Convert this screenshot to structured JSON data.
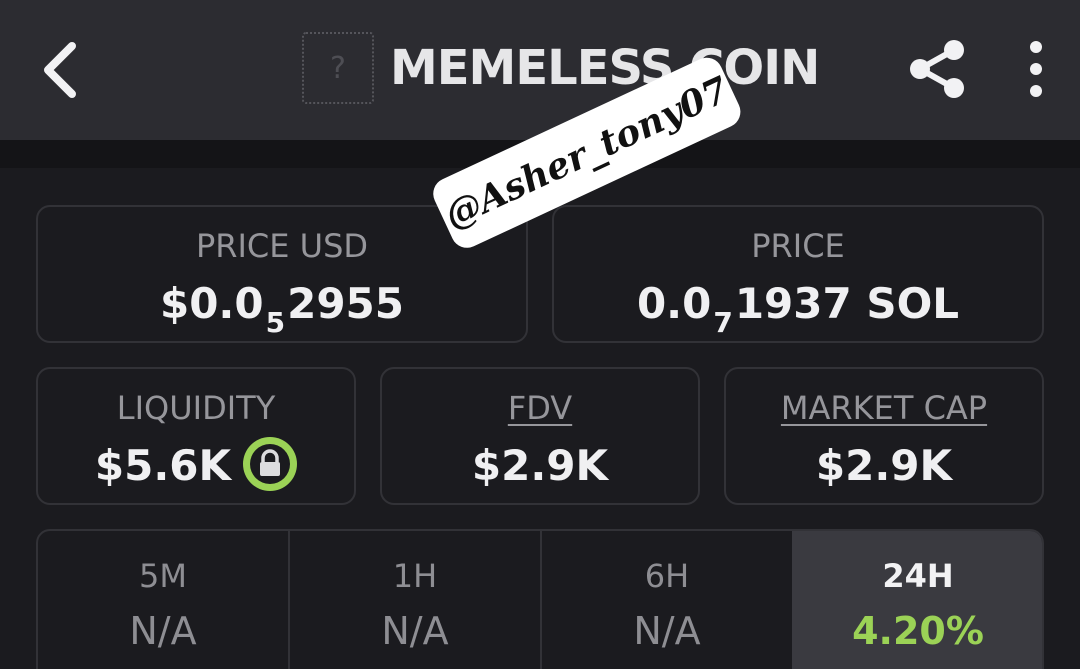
{
  "header": {
    "title": "MEMELESS COIN",
    "logo_placeholder": "?",
    "back_icon": "chevron-left-icon",
    "share_icon": "share-icon",
    "more_icon": "more-vertical-icon"
  },
  "stats": {
    "price_usd": {
      "label": "PRICE USD",
      "prefix": "$0.0",
      "zeros": "5",
      "digits": "2955"
    },
    "price_sol": {
      "label": "PRICE",
      "prefix": "0.0",
      "zeros": "7",
      "digits": "1937 SOL"
    },
    "liquidity": {
      "label": "LIQUIDITY",
      "value": "$5.6K",
      "lock_icon": "lock-icon"
    },
    "fdv": {
      "label": "FDV",
      "value": "$2.9K"
    },
    "market_cap": {
      "label": "MARKET CAP",
      "value": "$2.9K"
    }
  },
  "timeframes": [
    {
      "label": "5M",
      "value": "N/A",
      "active": false
    },
    {
      "label": "1H",
      "value": "N/A",
      "active": false
    },
    {
      "label": "6H",
      "value": "N/A",
      "active": false
    },
    {
      "label": "24H",
      "value": "4.20%",
      "active": true
    }
  ],
  "watermark": {
    "text": "@Asher_tony07"
  },
  "colors": {
    "accent_green": "#9bd256",
    "background": "#1b1b1f",
    "header_bg": "#2c2c31"
  }
}
